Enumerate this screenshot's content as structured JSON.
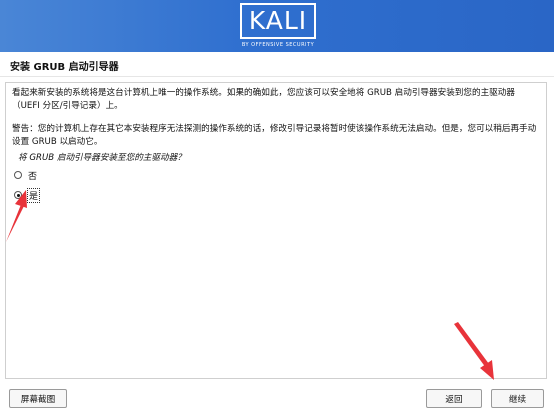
{
  "banner": {
    "logo_text": "KALI",
    "logo_subtext": "BY OFFENSIVE SECURITY",
    "color": "#2f6fcf"
  },
  "page": {
    "title": "安装 GRUB 启动引导器"
  },
  "body": {
    "paragraph1": "看起来新安装的系统将是这台计算机上唯一的操作系统。如果的确如此，您应该可以安全地将 GRUB 启动引导器安装到您的主驱动器（UEFI 分区/引导记录）上。",
    "paragraph2": "警告：您的计算机上存在其它本安装程序无法探测的操作系统的话，修改引导记录将暂时使该操作系统无法启动。但是，您可以稍后再手动设置 GRUB 以启动它。",
    "question": "将 GRUB 启动引导器安装至您的主驱动器？"
  },
  "options": [
    {
      "label": "否",
      "selected": false
    },
    {
      "label": "是",
      "selected": true
    }
  ],
  "buttons": {
    "screenshot": "屏幕截图",
    "back": "返回",
    "continue": "继续"
  },
  "annotation_color": "#e8333a"
}
